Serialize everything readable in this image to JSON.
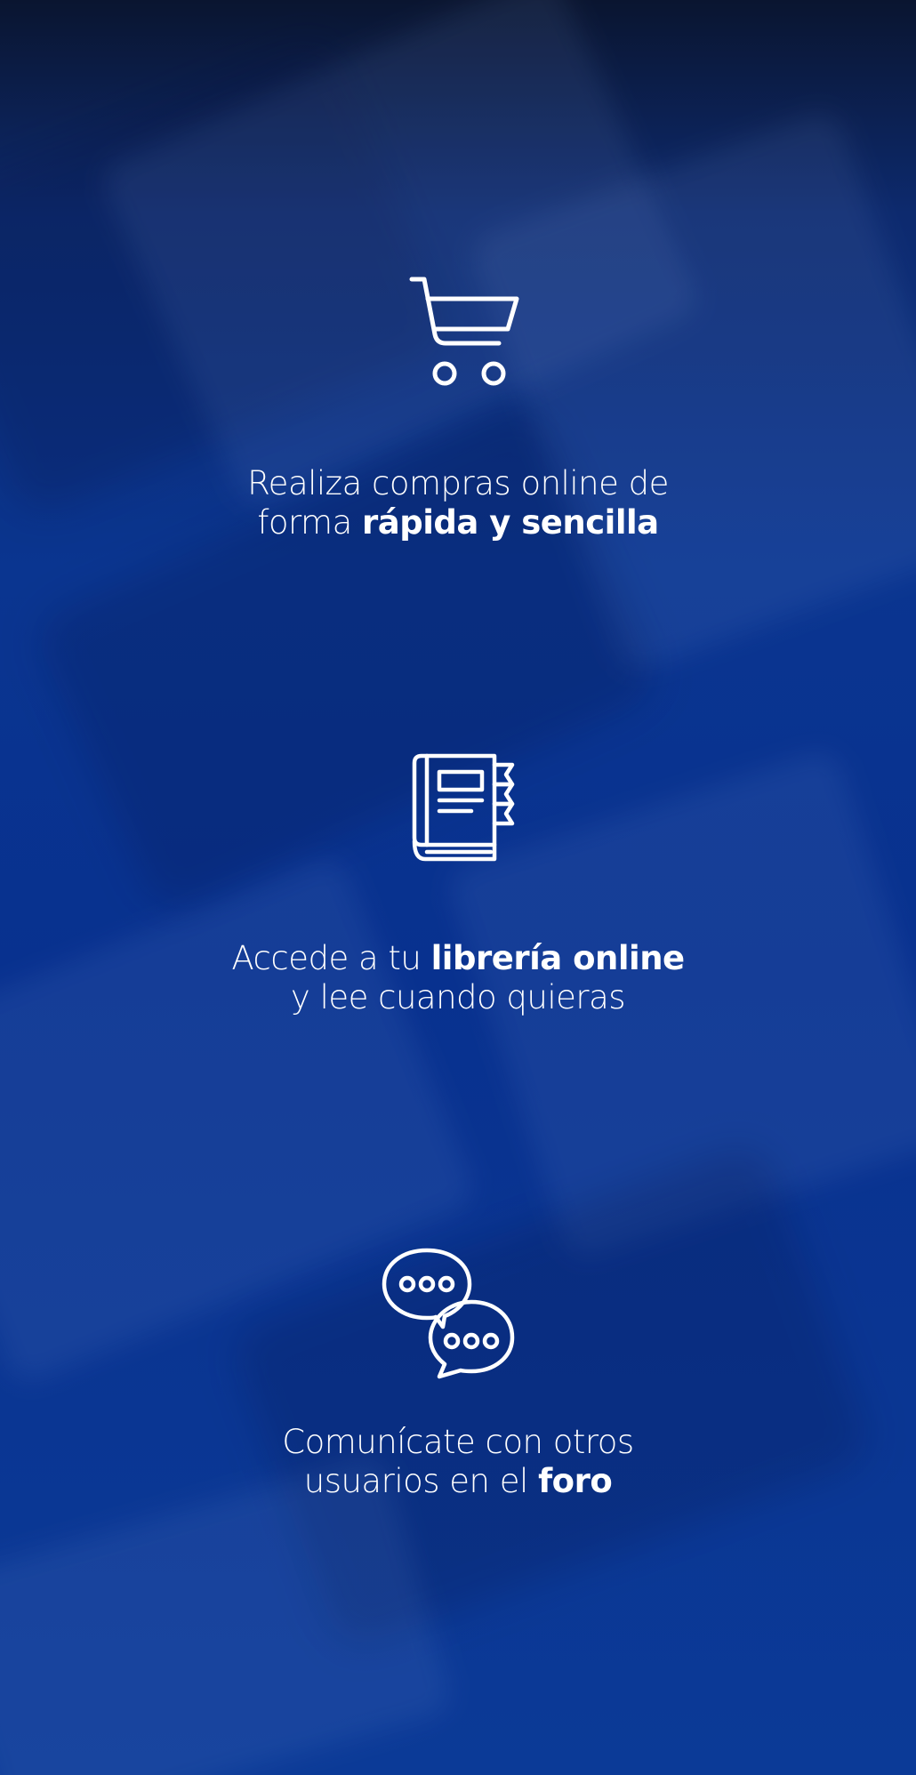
{
  "colors": {
    "background_top": "#0a1530",
    "background_main": "#08318f",
    "foreground": "#ffffff"
  },
  "features": [
    {
      "icon": "shopping-cart-icon",
      "line1": "Realiza compras online de",
      "line2_plain": "forma ",
      "line2_bold": "rápida y sencilla"
    },
    {
      "icon": "book-icon",
      "line1_plain": "Accede a tu ",
      "line1_bold": "librería online",
      "line2": "y lee cuando quieras"
    },
    {
      "icon": "chat-bubbles-icon",
      "line1": "Comunícate con otros",
      "line2_plain": "usuarios en el ",
      "line2_bold": "foro"
    }
  ]
}
